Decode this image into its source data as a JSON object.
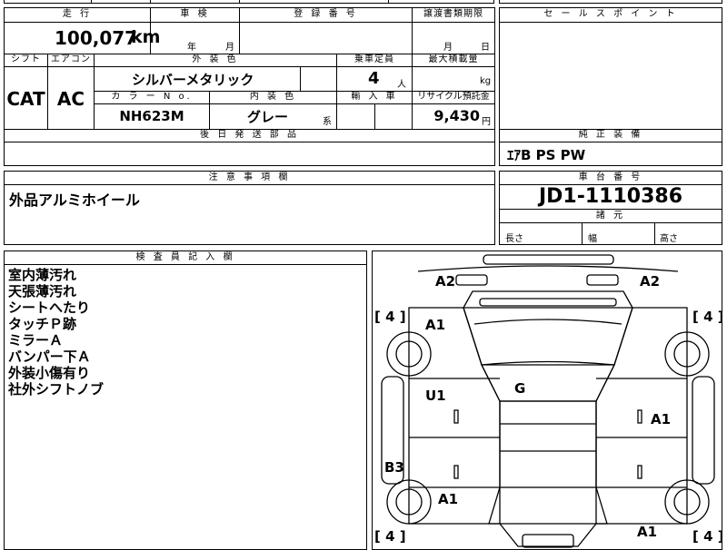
{
  "header": {
    "mileage_label": "走 行",
    "mileage_value": "100,077",
    "mileage_unit": "km",
    "inspection_label": "車 検",
    "inspection_year": "年",
    "inspection_month": "月",
    "registration_label": "登 録 番 号",
    "transfer_label": "譲渡書類期限",
    "transfer_month": "月",
    "transfer_day": "日"
  },
  "specs": {
    "shift_label": "シフト",
    "aircon_label": "エアコン",
    "exterior_color_label": "外 装 色",
    "capacity_label": "乗車定員",
    "max_load_label": "最大積載量",
    "shift_value": "CAT",
    "aircon_value": "AC",
    "exterior_color_value": "シルバーメタリック",
    "capacity_value": "4",
    "capacity_unit": "人",
    "max_load_unit": "kg",
    "color_no_label": "カ ラ ー N o.",
    "interior_color_label": "内 装 色",
    "import_label": "輸 入 車",
    "recycle_label": "リサイクル預託金",
    "color_no_value": "NH623M",
    "interior_color_value": "グレー",
    "interior_color_suffix": "系",
    "recycle_value": "9,430",
    "recycle_unit": "円",
    "later_parts_label": "後 日 発 送 部 品"
  },
  "sales_points": {
    "label": "セ ー ル ス ポ イ ン ト"
  },
  "genuine_equipment": {
    "label": "純 正 装 備",
    "value": "ｴｱB PS PW"
  },
  "caution": {
    "label": "注 意 事 項 欄",
    "value": "外品アルミホイール"
  },
  "chassis": {
    "label": "車 台 番 号",
    "value": "JD1-1110386",
    "dimensions_label": "諸 元",
    "length_label": "長さ",
    "width_label": "幅",
    "height_label": "高さ"
  },
  "inspector": {
    "label": "検 査 員 記 入 欄",
    "notes": [
      "室内薄汚れ",
      "天張薄汚れ",
      "シートへたり",
      "タッチＰ跡",
      "ミラーＡ",
      "バンパー下Ａ",
      "外装小傷有り",
      "社外シフトノブ"
    ]
  },
  "diagram": {
    "labels": {
      "front_left_top": "A2",
      "front_right_top": "A2",
      "left_fender": "A1",
      "hood_roof": "G",
      "left_front_door": "U1",
      "right_door": "A1",
      "left_rear_quarter": "B3",
      "left_rear": "A1",
      "right_rear": "A1"
    },
    "tire_depths": {
      "front_left": "[ 4 ]",
      "front_right": "[ 4 ]",
      "rear_left": "[ 4 ]",
      "rear_right": "[ 4 ]"
    }
  }
}
